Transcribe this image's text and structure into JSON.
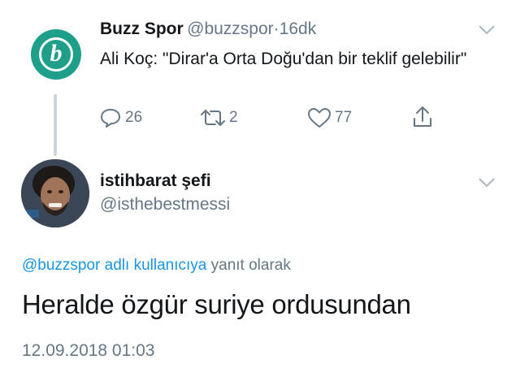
{
  "parent_tweet": {
    "display_name": "Buzz Spor",
    "handle": "@buzzspor",
    "separator": "·",
    "time_ago": "16dk",
    "text": "Ali Koç: \"Dirar'a Orta Doğu'dan bir teklif gelebilir\"",
    "avatar_letter": "b",
    "reply_count": "26",
    "retweet_count": "2",
    "like_count": "77"
  },
  "main_tweet": {
    "display_name": "istihbarat şefi",
    "handle": "@isthebestmessi",
    "reply_to_link": "@buzzspor adlı kullanıcıya",
    "reply_to_suffix": "yanıt olarak",
    "text": "Heralde özgür suriye ordusundan",
    "timestamp": "12.09.2018 01:03"
  },
  "colors": {
    "brand_green": "#1f9f8a",
    "link_blue": "#1b95e0",
    "muted_gray": "#657786"
  },
  "icons": [
    "reply-icon",
    "retweet-icon",
    "like-icon",
    "share-icon",
    "chevron-down-icon"
  ]
}
